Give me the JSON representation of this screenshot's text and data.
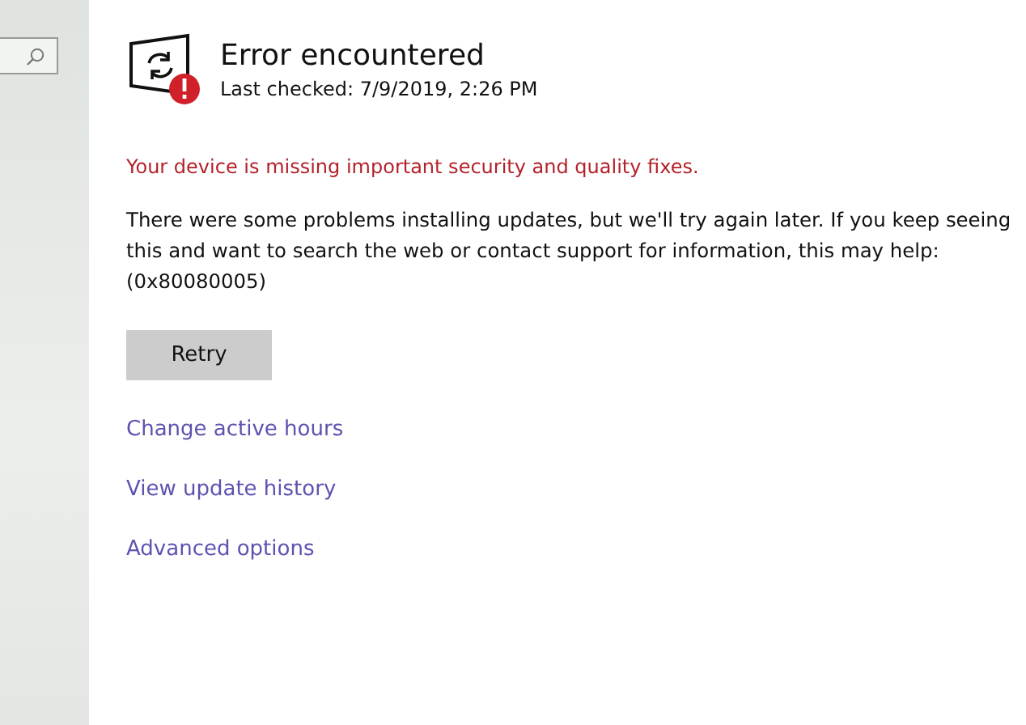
{
  "sidebar": {
    "search": {
      "kind": "search"
    }
  },
  "status": {
    "title": "Error encountered",
    "last_checked": "Last checked: 7/9/2019, 2:26 PM",
    "error": true
  },
  "warning": "Your device is missing important security and quality fixes.",
  "message": "There were some problems installing updates, but we'll try again later. If you keep seeing this and want to search the web or contact support for information, this may help: (0x80080005)",
  "buttons": [
    {
      "label": "Retry"
    }
  ],
  "links": [
    {
      "label": "Change active hours"
    },
    {
      "label": "View update history"
    },
    {
      "label": "Advanced options"
    }
  ]
}
